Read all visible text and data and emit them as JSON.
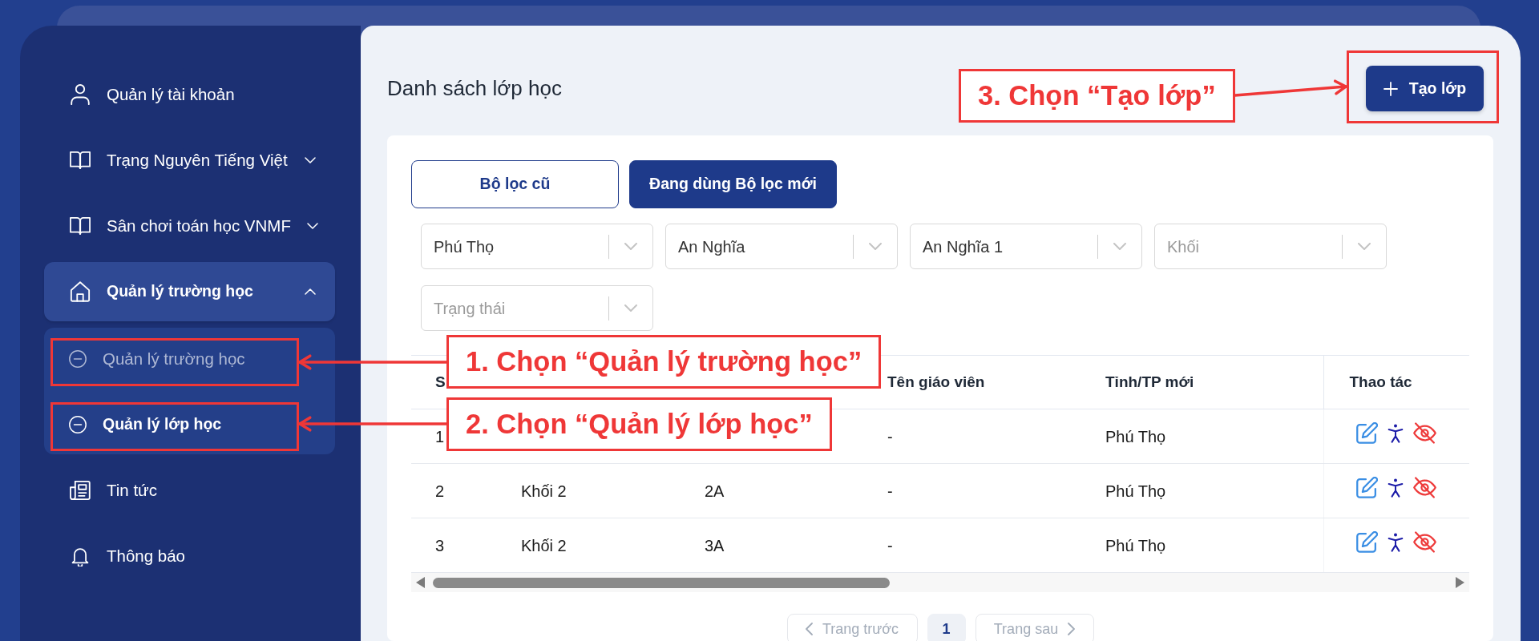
{
  "sidebar": {
    "items": [
      {
        "kind": "link",
        "label": "Quản lý tài khoản",
        "selected": false
      },
      {
        "kind": "group",
        "label": "Trạng Nguyên Tiếng Việt",
        "selected": false,
        "expanded": false
      },
      {
        "kind": "group",
        "label": "Sân chơi toán học VNMF",
        "selected": false,
        "expanded": false
      },
      {
        "kind": "group",
        "label": "Quản lý trường học",
        "selected": true,
        "expanded": true,
        "children": [
          {
            "label": "Quản lý trường học",
            "selected": false
          },
          {
            "label": "Quản lý lớp học",
            "selected": true
          }
        ]
      },
      {
        "kind": "link",
        "label": "Tin tức",
        "selected": false
      },
      {
        "kind": "link",
        "label": "Thông báo",
        "selected": false
      }
    ]
  },
  "header": {
    "title": "Danh sách lớp học",
    "create_button": "Tạo lớp"
  },
  "filter_modes": [
    {
      "label": "Bộ lọc cũ",
      "selected": false
    },
    {
      "label": "Đang dùng Bộ lọc mới",
      "selected": true
    }
  ],
  "filters": [
    {
      "value": "Phú Thọ"
    },
    {
      "value": "An Nghĩa"
    },
    {
      "value": "An Nghĩa 1"
    },
    {
      "placeholder": "Khối"
    },
    {
      "placeholder": "Trạng thái"
    }
  ],
  "table": {
    "columns": [
      "S",
      null,
      null,
      "Tên giáo viên",
      "Tỉnh/TP mới",
      "Thao tác"
    ],
    "rows": [
      {
        "cells": [
          "1",
          null,
          null,
          "-",
          "Phú Thọ"
        ]
      },
      {
        "cells": [
          "2",
          "Khối 2",
          "2A",
          "-",
          "Phú Thọ"
        ]
      },
      {
        "cells": [
          "3",
          "Khối 2",
          "3A",
          "-",
          "Phú Thọ"
        ]
      }
    ]
  },
  "pagination": {
    "previous": {
      "label": "Trang trước",
      "disabled": true
    },
    "pages": [
      {
        "label": "1",
        "selected": true
      }
    ],
    "next": {
      "label": "Trang sau",
      "disabled": true
    }
  },
  "annotations": [
    {
      "text": "1. Chọn “Quản lý trường học”"
    },
    {
      "text": "2. Chọn “Quản lý lớp học”"
    },
    {
      "text": "3. Chọn “Tạo lớp”"
    }
  ]
}
